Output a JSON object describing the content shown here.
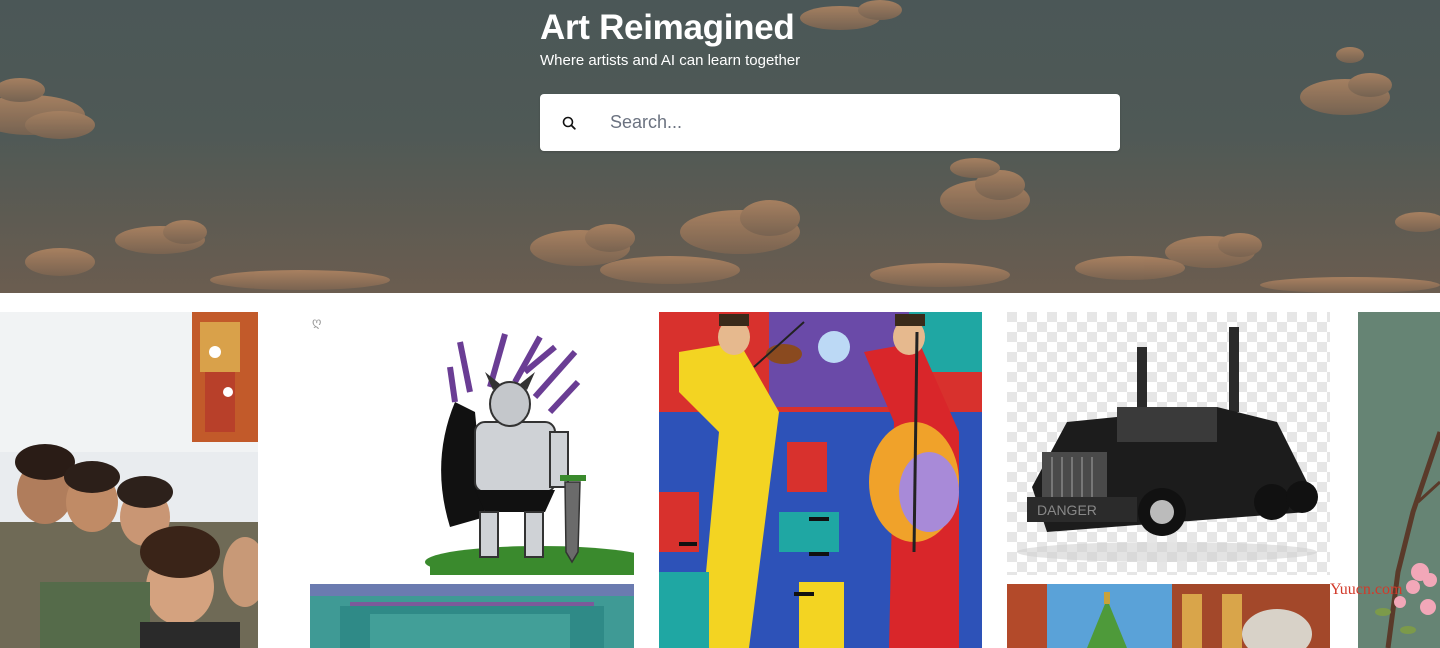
{
  "header": {
    "title": "Art Reimagined",
    "tagline": "Where artists and AI can learn together"
  },
  "search": {
    "placeholder": "Search...",
    "value": "",
    "icon": "search-icon"
  },
  "gallery": {
    "items": [
      {
        "name": "family-photo",
        "accent": "#b98f6c"
      },
      {
        "name": "armored-knight-drawing",
        "accent": "#6a3d94"
      },
      {
        "name": "teal-building",
        "accent": "#3a8f8f"
      },
      {
        "name": "musicians-painting",
        "accent": "#d62c2c"
      },
      {
        "name": "black-semi-truck",
        "accent": "#1f1f1f"
      },
      {
        "name": "ornate-temple",
        "accent": "#8b4a2b"
      },
      {
        "name": "blossom-branch",
        "accent": "#5f7e6e"
      }
    ]
  },
  "watermark": "Yuucn.com",
  "colors": {
    "hero": "#4e5857",
    "search_bg": "#ffffff",
    "title": "#ffffff"
  }
}
